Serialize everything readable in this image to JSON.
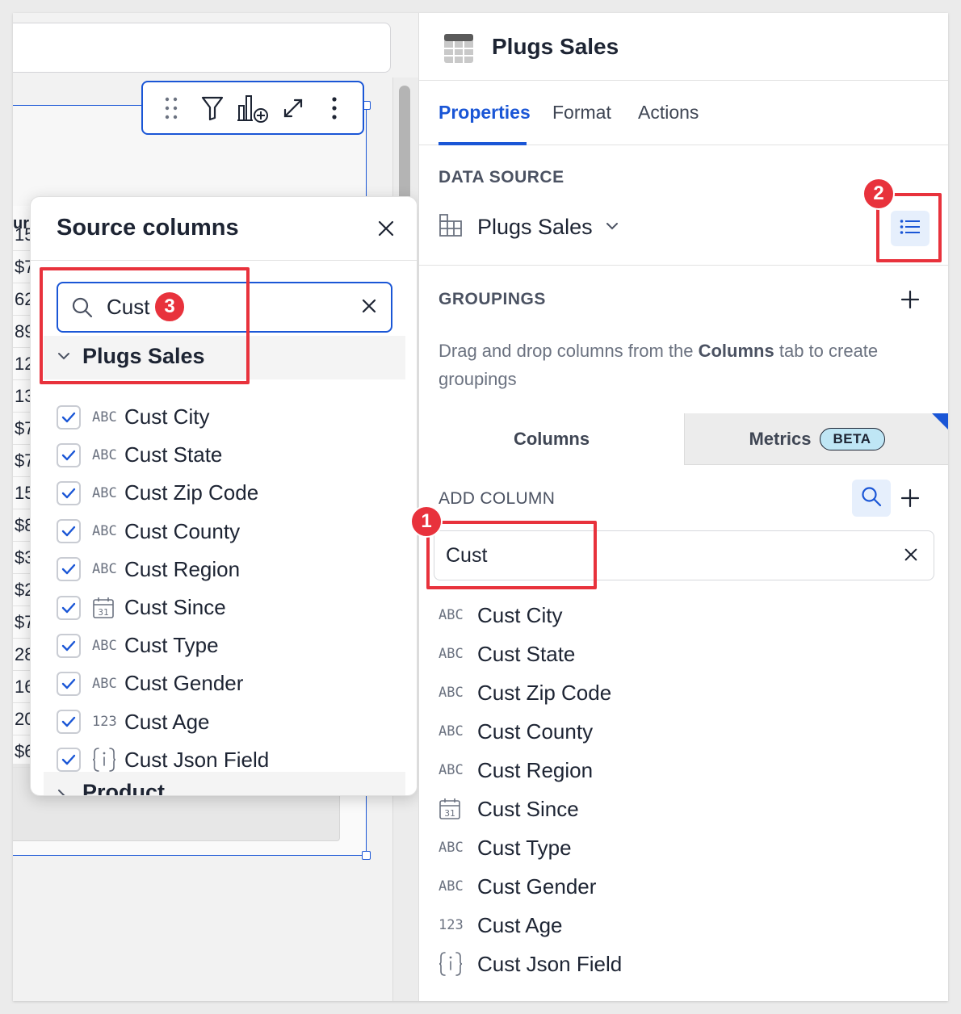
{
  "popover": {
    "title": "Source columns",
    "search_value": "Cust",
    "group_label": "Plugs Sales",
    "next_group_label": "Product",
    "items": [
      {
        "type": "ABC",
        "label": "Cust City"
      },
      {
        "type": "ABC",
        "label": "Cust State"
      },
      {
        "type": "ABC",
        "label": "Cust Zip Code"
      },
      {
        "type": "ABC",
        "label": "Cust County"
      },
      {
        "type": "ABC",
        "label": "Cust Region"
      },
      {
        "type": "calendar",
        "label": "Cust Since"
      },
      {
        "type": "ABC",
        "label": "Cust Type"
      },
      {
        "type": "ABC",
        "label": "Cust Gender"
      },
      {
        "type": "123",
        "label": "Cust Age"
      },
      {
        "type": "json",
        "label": "Cust Json Field"
      }
    ]
  },
  "table_fragments": {
    "header": "ur",
    "cells": [
      "15",
      "$7",
      "62",
      "89",
      "12",
      "13",
      "$7",
      "$7",
      "15",
      "$8",
      "$3",
      "$2",
      "$7",
      "28",
      "16",
      "20",
      "$6"
    ]
  },
  "panel": {
    "title": "Plugs Sales",
    "tabs": [
      "Properties",
      "Format",
      "Actions"
    ],
    "active_tab": "Properties",
    "data_source_label": "DATA SOURCE",
    "data_source_name": "Plugs Sales",
    "groupings_label": "GROUPINGS",
    "groupings_hint_pre": "Drag and drop columns from the ",
    "groupings_hint_bold": "Columns",
    "groupings_hint_post": " tab to create groupings",
    "col_tab_columns": "Columns",
    "col_tab_metrics": "Metrics",
    "beta_badge": "BETA",
    "add_column_label": "ADD COLUMN",
    "column_search_value": "Cust",
    "columns": [
      {
        "type": "ABC",
        "label": "Cust City"
      },
      {
        "type": "ABC",
        "label": "Cust State"
      },
      {
        "type": "ABC",
        "label": "Cust Zip Code"
      },
      {
        "type": "ABC",
        "label": "Cust County"
      },
      {
        "type": "ABC",
        "label": "Cust Region"
      },
      {
        "type": "calendar",
        "label": "Cust Since"
      },
      {
        "type": "ABC",
        "label": "Cust Type"
      },
      {
        "type": "ABC",
        "label": "Cust Gender"
      },
      {
        "type": "123",
        "label": "Cust Age"
      },
      {
        "type": "json",
        "label": "Cust Json Field"
      }
    ]
  },
  "callouts": [
    "1",
    "2",
    "3"
  ],
  "colors": {
    "accent": "#1a56d6",
    "callout": "#e8323c",
    "beta_bg": "#bfe6f5"
  },
  "icons": {
    "toolbar": [
      "drag-handle-icon",
      "filter-icon",
      "add-chart-icon",
      "expand-icon",
      "more-icon"
    ],
    "panel_header": "table-icon",
    "data_source": "table-icon",
    "data_source_action": "list-icon",
    "search": "search-icon",
    "close": "close-icon"
  }
}
